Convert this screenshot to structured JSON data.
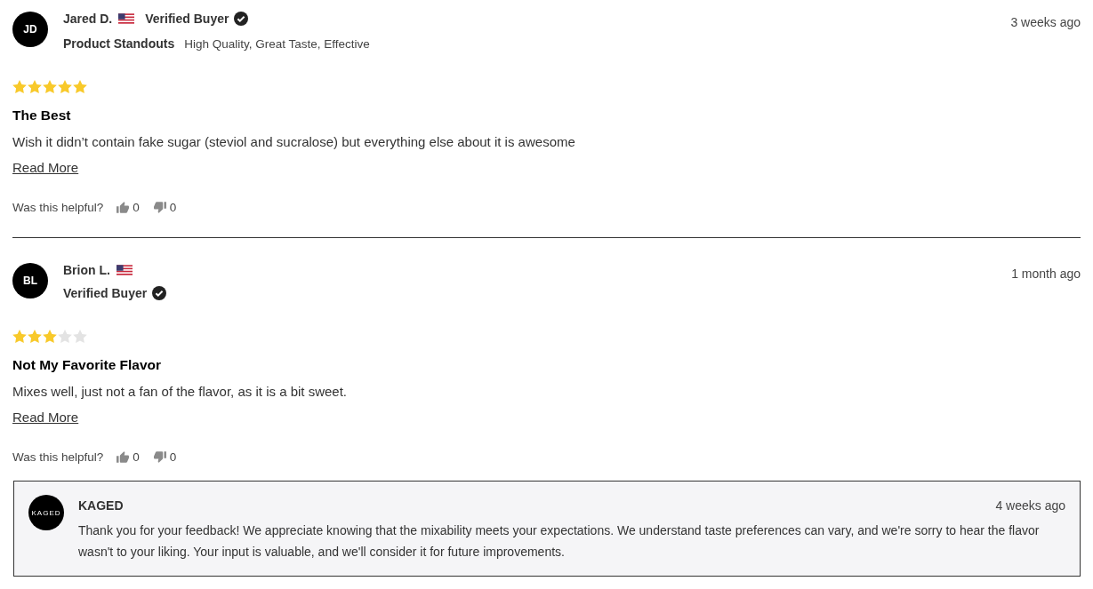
{
  "reviews": [
    {
      "initials": "JD",
      "name": "Jared D.",
      "verified": "Verified Buyer",
      "standouts_label": "Product Standouts",
      "standouts": "High Quality, Great Taste, Effective",
      "date": "3 weeks ago",
      "stars": 5,
      "title": "The Best",
      "body": "Wish it didn’t contain fake sugar (steviol and sucralose) but everything else about it is awesome",
      "read_more": "Read More",
      "helpful_label": "Was this helpful?",
      "helpful_yes": "0",
      "helpful_no": "0"
    },
    {
      "initials": "BL",
      "name": "Brion L.",
      "verified": "Verified Buyer",
      "date": "1 month ago",
      "stars": 3,
      "title": "Not My Favorite Flavor",
      "body": "Mixes well, just not a fan of the flavor, as it is a bit sweet.",
      "read_more": "Read More",
      "helpful_label": "Was this helpful?",
      "helpful_yes": "0",
      "helpful_no": "0",
      "reply": {
        "logo_text": "KAGED",
        "author": "KAGED",
        "date": "4 weeks ago",
        "body": "Thank you for your feedback! We appreciate knowing that the mixability meets your expectations. We understand taste preferences can vary, and we're sorry to hear the flavor wasn't to your liking. Your input is valuable, and we'll consider it for future improvements."
      }
    }
  ]
}
